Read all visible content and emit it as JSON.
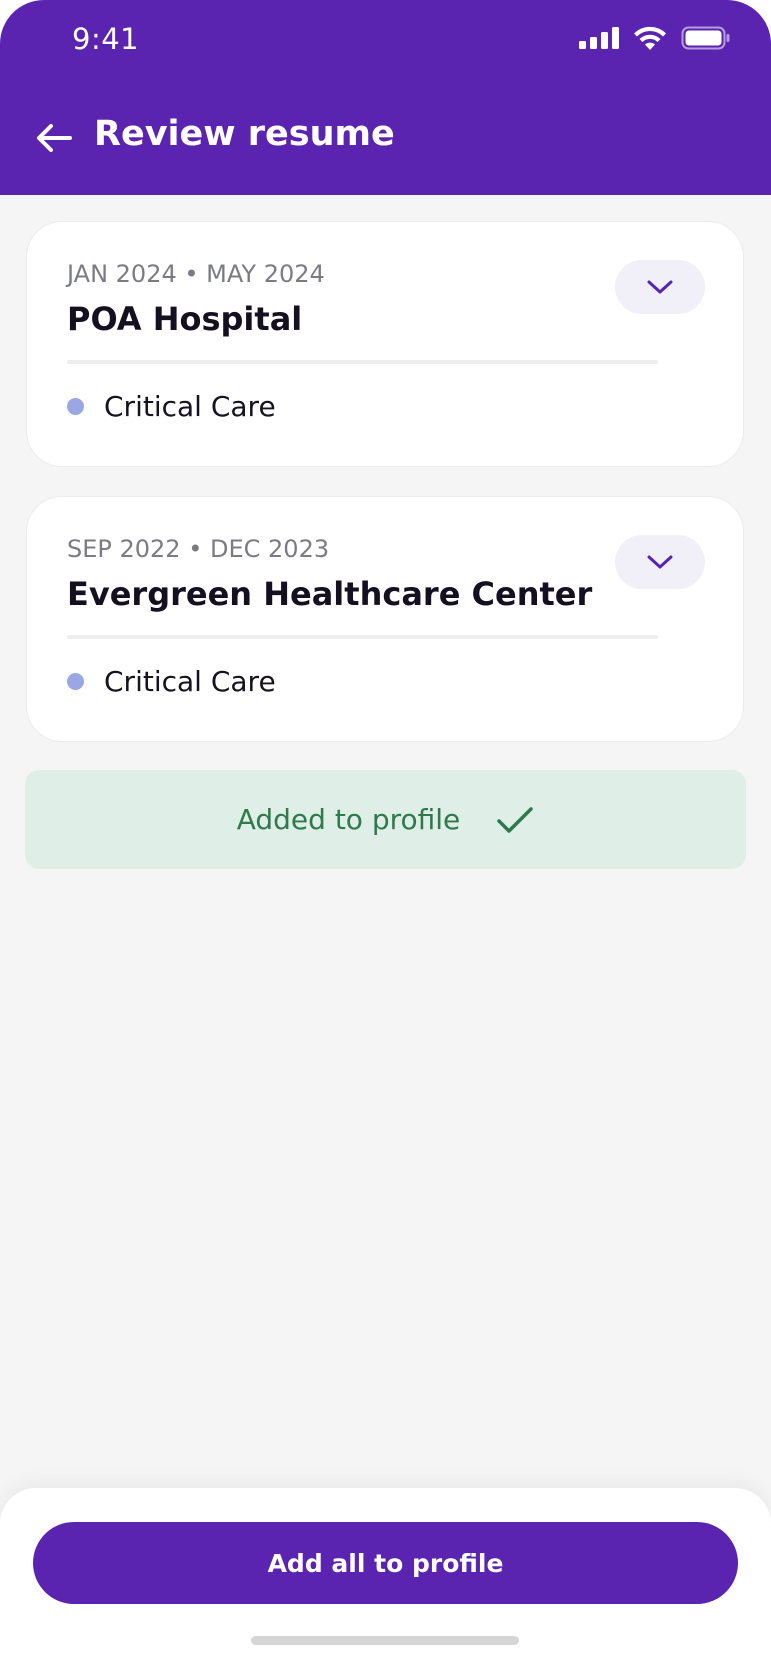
{
  "status_bar": {
    "time": "9:41"
  },
  "header": {
    "title": "Review resume",
    "back_icon": "arrow-left-icon"
  },
  "experiences": [
    {
      "dates": "JAN 2024 • MAY 2024",
      "employer": "POA Hospital",
      "specialty": "Critical Care"
    },
    {
      "dates": "SEP 2022 • DEC 2023",
      "employer": "Evergreen Healthcare Center",
      "specialty": "Critical Care"
    }
  ],
  "banner": {
    "text": "Added to profile",
    "icon": "check-icon"
  },
  "footer": {
    "button_label": "Add all to profile"
  },
  "colors": {
    "brand": "#5b24b0",
    "success_bg": "#dfeee6",
    "success_text": "#2f7a4a",
    "bullet": "#9ba7e3"
  }
}
